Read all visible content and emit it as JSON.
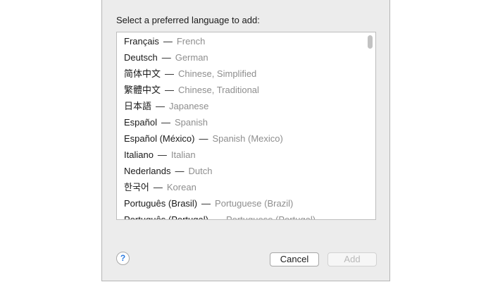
{
  "dialog": {
    "prompt": "Select a preferred language to add:",
    "languages": [
      {
        "native": "Français",
        "english": "French"
      },
      {
        "native": "Deutsch",
        "english": "German"
      },
      {
        "native": "简体中文",
        "english": "Chinese, Simplified"
      },
      {
        "native": "繁體中文",
        "english": "Chinese, Traditional"
      },
      {
        "native": "日本語",
        "english": "Japanese"
      },
      {
        "native": "Español",
        "english": "Spanish"
      },
      {
        "native": "Español (México)",
        "english": "Spanish (Mexico)"
      },
      {
        "native": "Italiano",
        "english": "Italian"
      },
      {
        "native": "Nederlands",
        "english": "Dutch"
      },
      {
        "native": "한국어",
        "english": "Korean"
      },
      {
        "native": "Português (Brasil)",
        "english": "Portuguese (Brazil)"
      },
      {
        "native": "Português (Portugal)",
        "english": "Portuguese (Portugal)"
      }
    ],
    "separator": "—",
    "help_label": "?",
    "cancel_label": "Cancel",
    "add_label": "Add",
    "add_enabled": false
  },
  "icons": {
    "help": "question-mark-icon"
  },
  "colors": {
    "window_background": "#ececec",
    "list_background": "#ffffff",
    "secondary_text": "#8e8e8e",
    "help_accent": "#2f7de1",
    "disabled_text": "#b9b9b9"
  }
}
